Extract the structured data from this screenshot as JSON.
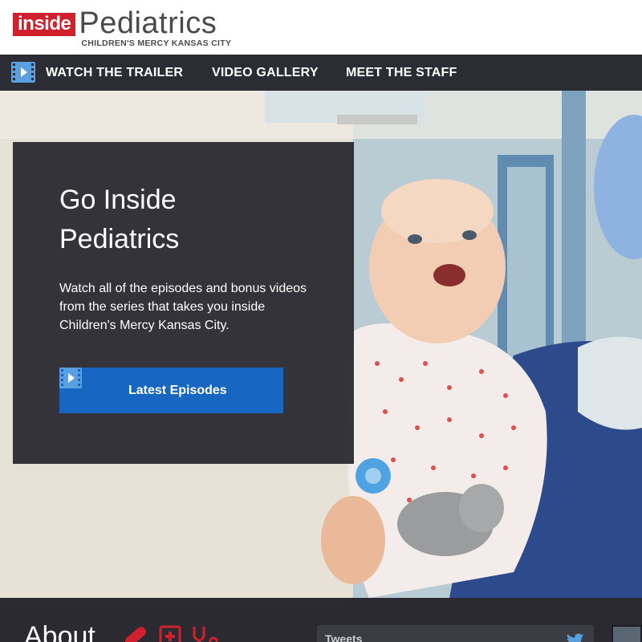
{
  "header": {
    "logo_inside": "inside",
    "logo_main": "Pediatrics",
    "logo_sub": "CHILDREN'S MERCY KANSAS CITY"
  },
  "nav": {
    "icon": "film-icon",
    "items": [
      {
        "label": "WATCH THE TRAILER"
      },
      {
        "label": "VIDEO GALLERY"
      },
      {
        "label": "MEET THE STAFF"
      }
    ]
  },
  "hero": {
    "title_line1": "Go Inside",
    "title_line2": "Pediatrics",
    "description": "Watch all of the episodes and bonus videos from the series that takes you inside Children's Mercy Kansas City.",
    "button_label": "Latest Episodes",
    "button_icon": "film-icon",
    "image": "photo of a smiling baby held by a nurse in a hospital hallway"
  },
  "about": {
    "heading": "About",
    "icons": [
      "bandage-icon",
      "medical-chart-icon",
      "stethoscope-icon"
    ]
  },
  "tweets": {
    "label": "Tweets",
    "icon": "twitter-icon"
  },
  "colors": {
    "brand_red": "#d0202e",
    "nav_bg": "#2c2c34",
    "button_blue": "#1766c1",
    "panel_bg": "#2c2c32",
    "icon_blue": "#5aa0e0"
  }
}
